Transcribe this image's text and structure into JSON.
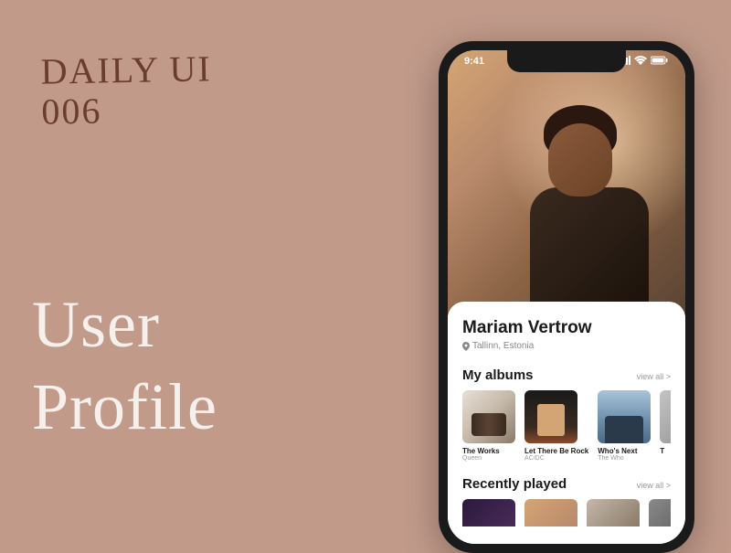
{
  "background": {
    "heading_line1": "DAILY UI",
    "heading_line2": "006",
    "title_line1": "User",
    "title_line2": "Profile"
  },
  "status_bar": {
    "time": "9:41"
  },
  "profile": {
    "name": "Mariam Vertrow",
    "location": "Tallinn, Estonia"
  },
  "sections": {
    "albums": {
      "title": "My albums",
      "view_all": "view all >",
      "items": [
        {
          "title": "The Works",
          "artist": "Queen"
        },
        {
          "title": "Let There Be Rock",
          "artist": "AC/DC"
        },
        {
          "title": "Who's Next",
          "artist": "The Who"
        },
        {
          "title": "T",
          "artist": ""
        }
      ]
    },
    "recent": {
      "title": "Recently played",
      "view_all": "view all >"
    }
  }
}
